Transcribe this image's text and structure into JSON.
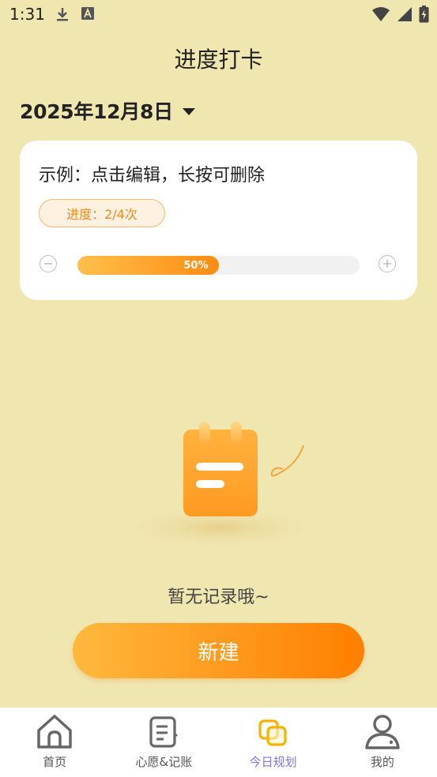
{
  "status_bar": {
    "time": "1:31",
    "left_icons": [
      "download-icon",
      "font-a-icon"
    ],
    "right_icons": [
      "wifi-icon",
      "signal-icon",
      "battery-charging-icon"
    ]
  },
  "header": {
    "title": "进度打卡"
  },
  "date_picker": {
    "value": "2025年12月8日",
    "icon": "caret-down-icon"
  },
  "card": {
    "title": "示例：点击编辑，长按可删除",
    "progress_text": "进度：2/4次",
    "progress_fraction": 0.5,
    "progress_label": "50%",
    "decrement_icon": "minus-circle-icon",
    "increment_icon": "plus-circle-icon"
  },
  "empty_state": {
    "illustration": "notebook-illustration",
    "text": "暂无记录哦~"
  },
  "new_button": {
    "label": "新建"
  },
  "bottom_nav": {
    "items": [
      {
        "label": "首页",
        "icon": "home-icon",
        "active": false
      },
      {
        "label": "心愿&记账",
        "icon": "note-list-icon",
        "active": false
      },
      {
        "label": "今日规划",
        "icon": "plan-squares-icon",
        "active": true
      },
      {
        "label": "我的",
        "icon": "user-icon",
        "active": false
      }
    ]
  },
  "colors": {
    "background": "#F0E6B0",
    "accent_orange": "#FF8A12",
    "active_nav": "#7F75E8",
    "card": "#FFFFFF"
  }
}
